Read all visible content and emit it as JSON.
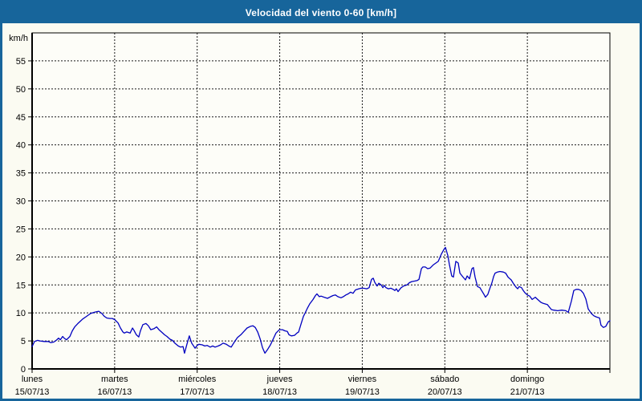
{
  "window": {
    "title": "Velocidad del viento 0-60 [km/h]"
  },
  "colors": {
    "frame": "#17659b",
    "titlebar_bg": "#17659b",
    "title_text": "#ffffff",
    "content_bg": "#fbfbf2",
    "plot_bg": "#fdfdf8",
    "axis": "#000000",
    "grid": "#1a1a1a",
    "label": "#000000",
    "line": "#0000c0"
  },
  "chart_data": {
    "type": "line",
    "title": "Velocidad del viento 0-60 [km/h]",
    "unit_label": "km/h",
    "ylabel": "km/h",
    "xlabel": "",
    "ylim": [
      0,
      60
    ],
    "yticks": [
      0,
      5,
      10,
      15,
      20,
      25,
      30,
      35,
      40,
      45,
      50,
      55
    ],
    "grid": "dashed",
    "legend": "none",
    "x_unit": "hours since lunes 00:00",
    "xlim": [
      0,
      168
    ],
    "day_span_hours": 24,
    "day_labels": [
      {
        "name": "lunes",
        "date": "15/07/13",
        "hour": 0
      },
      {
        "name": "martes",
        "date": "16/07/13",
        "hour": 24
      },
      {
        "name": "miércoles",
        "date": "17/07/13",
        "hour": 48
      },
      {
        "name": "jueves",
        "date": "18/07/13",
        "hour": 72
      },
      {
        "name": "viernes",
        "date": "19/07/13",
        "hour": 96
      },
      {
        "name": "sábado",
        "date": "20/07/13",
        "hour": 120
      },
      {
        "name": "domingo",
        "date": "21/07/13",
        "hour": 144
      }
    ],
    "series": [
      {
        "name": "Velocidad del viento",
        "color": "#0000c0",
        "points": [
          [
            0,
            4.0
          ],
          [
            0.7,
            4.9
          ],
          [
            1.6,
            5.1
          ],
          [
            2.3,
            5.0
          ],
          [
            3.5,
            4.9
          ],
          [
            4.7,
            4.9
          ],
          [
            5.4,
            4.7
          ],
          [
            6.3,
            4.8
          ],
          [
            7,
            5.1
          ],
          [
            7.7,
            5.5
          ],
          [
            8.2,
            5.2
          ],
          [
            8.9,
            5.8
          ],
          [
            9.3,
            5.5
          ],
          [
            10,
            5.2
          ],
          [
            11,
            5.8
          ],
          [
            11.7,
            6.8
          ],
          [
            12.4,
            7.5
          ],
          [
            13.3,
            8.1
          ],
          [
            14,
            8.5
          ],
          [
            14.7,
            8.9
          ],
          [
            15.6,
            9.3
          ],
          [
            16.3,
            9.6
          ],
          [
            17,
            9.9
          ],
          [
            18,
            10.1
          ],
          [
            18.7,
            10.2
          ],
          [
            19.4,
            10.3
          ],
          [
            20.3,
            9.9
          ],
          [
            21,
            9.4
          ],
          [
            21.7,
            9.1
          ],
          [
            22.6,
            9.0
          ],
          [
            23.3,
            9.0
          ],
          [
            24,
            8.8
          ],
          [
            25,
            8.2
          ],
          [
            25.7,
            7.3
          ],
          [
            26.4,
            6.6
          ],
          [
            26.8,
            6.4
          ],
          [
            27.5,
            6.6
          ],
          [
            28.5,
            6.4
          ],
          [
            29.2,
            7.3
          ],
          [
            29.6,
            6.9
          ],
          [
            30.3,
            6.1
          ],
          [
            31,
            5.7
          ],
          [
            31.5,
            6.8
          ],
          [
            32.2,
            7.9
          ],
          [
            33.1,
            8.1
          ],
          [
            33.8,
            7.7
          ],
          [
            34.5,
            7.0
          ],
          [
            35.5,
            7.2
          ],
          [
            36.2,
            7.5
          ],
          [
            36.9,
            7.0
          ],
          [
            37.8,
            6.5
          ],
          [
            38.5,
            6.1
          ],
          [
            39.2,
            5.8
          ],
          [
            40.1,
            5.3
          ],
          [
            40.8,
            5.1
          ],
          [
            41.5,
            4.6
          ],
          [
            42.5,
            4.1
          ],
          [
            43.2,
            3.9
          ],
          [
            43.9,
            4.0
          ],
          [
            44.3,
            2.8
          ],
          [
            45,
            4.4
          ],
          [
            45.7,
            5.9
          ],
          [
            46.4,
            4.6
          ],
          [
            47.4,
            3.7
          ],
          [
            48,
            4.2
          ],
          [
            48.5,
            4.4
          ],
          [
            49.5,
            4.3
          ],
          [
            50.2,
            4.1
          ],
          [
            50.9,
            4.2
          ],
          [
            51.8,
            3.9
          ],
          [
            52.5,
            4.1
          ],
          [
            53.2,
            3.9
          ],
          [
            54.1,
            4.1
          ],
          [
            54.8,
            4.3
          ],
          [
            55.5,
            4.6
          ],
          [
            56.5,
            4.4
          ],
          [
            57.2,
            4.1
          ],
          [
            57.9,
            3.9
          ],
          [
            58.8,
            4.8
          ],
          [
            59.7,
            5.6
          ],
          [
            60.7,
            6.1
          ],
          [
            61.6,
            6.7
          ],
          [
            62.5,
            7.3
          ],
          [
            63.5,
            7.6
          ],
          [
            64.2,
            7.7
          ],
          [
            64.9,
            7.4
          ],
          [
            65.6,
            6.6
          ],
          [
            66.3,
            5.4
          ],
          [
            67,
            3.8
          ],
          [
            67.7,
            2.8
          ],
          [
            68.4,
            3.4
          ],
          [
            69.3,
            4.3
          ],
          [
            70,
            5.2
          ],
          [
            70.9,
            6.4
          ],
          [
            71.9,
            7.0
          ],
          [
            72.8,
            7.0
          ],
          [
            73.5,
            6.8
          ],
          [
            74.2,
            6.7
          ],
          [
            74.7,
            6.1
          ],
          [
            75.4,
            5.9
          ],
          [
            76.3,
            6.0
          ],
          [
            77,
            6.4
          ],
          [
            77.5,
            6.6
          ],
          [
            78.2,
            8.0
          ],
          [
            78.9,
            9.4
          ],
          [
            79.3,
            9.9
          ],
          [
            80,
            10.8
          ],
          [
            80.7,
            11.6
          ],
          [
            81.7,
            12.4
          ],
          [
            82.4,
            13.1
          ],
          [
            82.8,
            13.4
          ],
          [
            83.5,
            12.9
          ],
          [
            84,
            13.0
          ],
          [
            84.9,
            12.8
          ],
          [
            85.9,
            12.6
          ],
          [
            86.8,
            12.9
          ],
          [
            87.5,
            13.1
          ],
          [
            88.2,
            13.2
          ],
          [
            88.9,
            12.9
          ],
          [
            89.8,
            12.7
          ],
          [
            90.5,
            12.9
          ],
          [
            91.2,
            13.2
          ],
          [
            91.9,
            13.4
          ],
          [
            92.6,
            13.7
          ],
          [
            93.3,
            13.5
          ],
          [
            94,
            14.1
          ],
          [
            95,
            14.3
          ],
          [
            95.7,
            14.4
          ],
          [
            96.4,
            14.4
          ],
          [
            97.3,
            14.3
          ],
          [
            98,
            14.5
          ],
          [
            98.7,
            16.0
          ],
          [
            99.2,
            16.2
          ],
          [
            99.6,
            15.5
          ],
          [
            100.3,
            14.8
          ],
          [
            100.8,
            15.3
          ],
          [
            101.5,
            15.0
          ],
          [
            102,
            14.5
          ],
          [
            102.4,
            14.9
          ],
          [
            102.9,
            14.5
          ],
          [
            103.6,
            14.3
          ],
          [
            104.3,
            14.4
          ],
          [
            105,
            14.2
          ],
          [
            105.5,
            14.0
          ],
          [
            105.9,
            14.3
          ],
          [
            106.4,
            13.8
          ],
          [
            106.9,
            14.2
          ],
          [
            107.3,
            14.5
          ],
          [
            108,
            14.8
          ],
          [
            109,
            15.0
          ],
          [
            109.7,
            15.4
          ],
          [
            110.4,
            15.6
          ],
          [
            111.3,
            15.7
          ],
          [
            112,
            15.8
          ],
          [
            112.5,
            16.0
          ],
          [
            113.2,
            17.9
          ],
          [
            113.6,
            18.2
          ],
          [
            114.3,
            18.2
          ],
          [
            115,
            17.9
          ],
          [
            115.7,
            18.0
          ],
          [
            116.7,
            18.6
          ],
          [
            117.4,
            18.9
          ],
          [
            118.1,
            19.2
          ],
          [
            119,
            20.5
          ],
          [
            119.7,
            21.3
          ],
          [
            120.2,
            21.7
          ],
          [
            120.9,
            20.2
          ],
          [
            121.3,
            18.7
          ],
          [
            122,
            16.6
          ],
          [
            122.5,
            16.4
          ],
          [
            123.2,
            19.2
          ],
          [
            123.9,
            18.9
          ],
          [
            124.4,
            17.1
          ],
          [
            125.3,
            16.4
          ],
          [
            126,
            15.9
          ],
          [
            126.5,
            16.6
          ],
          [
            127.2,
            16.1
          ],
          [
            127.9,
            17.9
          ],
          [
            128.3,
            18.1
          ],
          [
            128.8,
            16.4
          ],
          [
            129.5,
            14.7
          ],
          [
            130.2,
            14.5
          ],
          [
            130.7,
            14.0
          ],
          [
            131.4,
            13.3
          ],
          [
            131.8,
            12.8
          ],
          [
            132.5,
            13.3
          ],
          [
            133,
            14.2
          ],
          [
            133.7,
            15.4
          ],
          [
            134.2,
            16.5
          ],
          [
            134.6,
            17.1
          ],
          [
            135.3,
            17.3
          ],
          [
            136,
            17.4
          ],
          [
            137,
            17.3
          ],
          [
            137.7,
            17.1
          ],
          [
            138.4,
            16.4
          ],
          [
            139.3,
            15.9
          ],
          [
            140,
            15.2
          ],
          [
            140.7,
            14.6
          ],
          [
            141.2,
            14.3
          ],
          [
            141.6,
            14.7
          ],
          [
            142.3,
            14.5
          ],
          [
            142.8,
            14.0
          ],
          [
            143.3,
            13.6
          ],
          [
            144,
            13.2
          ],
          [
            144.7,
            13.0
          ],
          [
            145.4,
            12.4
          ],
          [
            146.3,
            12.8
          ],
          [
            147,
            12.4
          ],
          [
            147.9,
            11.9
          ],
          [
            148.6,
            11.7
          ],
          [
            149.8,
            11.5
          ],
          [
            151,
            10.6
          ],
          [
            151.7,
            10.5
          ],
          [
            152.8,
            10.4
          ],
          [
            154,
            10.5
          ],
          [
            155.2,
            10.4
          ],
          [
            155.9,
            10.1
          ],
          [
            156.8,
            12.1
          ],
          [
            157.5,
            14.0
          ],
          [
            158.2,
            14.2
          ],
          [
            158.9,
            14.2
          ],
          [
            159.6,
            14.0
          ],
          [
            160.3,
            13.5
          ],
          [
            161,
            12.5
          ],
          [
            161.7,
            10.7
          ],
          [
            162.6,
            9.9
          ],
          [
            163.3,
            9.5
          ],
          [
            164,
            9.3
          ],
          [
            165,
            9.1
          ],
          [
            165.4,
            7.8
          ],
          [
            166.1,
            7.4
          ],
          [
            166.8,
            7.6
          ],
          [
            167.5,
            8.4
          ],
          [
            168,
            8.6
          ]
        ]
      }
    ]
  }
}
